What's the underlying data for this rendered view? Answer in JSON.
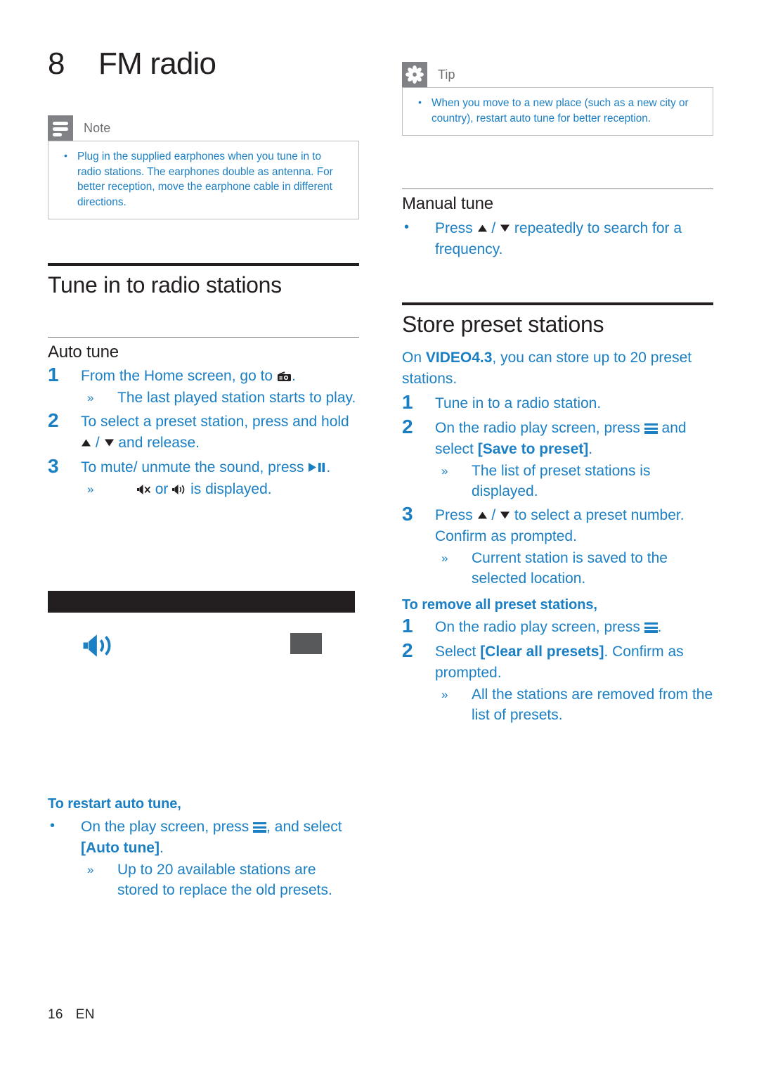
{
  "chapter": {
    "number": "8",
    "title": "FM radio"
  },
  "note_box": {
    "icon": "note-icon",
    "label": "Note",
    "items": [
      "Plug in the supplied earphones when you tune in to radio stations. The earphones double as antenna. For better reception, move the earphone cable in different directions."
    ]
  },
  "tip_box": {
    "icon": "tip-icon",
    "label": "Tip",
    "items": [
      "When you move to a new place (such as a new city or country), restart auto tune for better reception."
    ]
  },
  "section_tune": {
    "heading": "Tune in to radio stations",
    "auto_tune": {
      "heading": "Auto tune",
      "steps": [
        {
          "num": "1",
          "text_before": "From the Home screen, go to",
          "icon": "radio-icon",
          "text_after": ".",
          "results": [
            "The last played station starts to play."
          ]
        },
        {
          "num": "2",
          "text_before": "To select a preset station, press and hold",
          "icon": "arrow-up-icon",
          "text_mid": "/",
          "icon2": "arrow-down-icon",
          "text_after": "and release.",
          "results": []
        },
        {
          "num": "3",
          "text_before": "To mute/ unmute the sound, press",
          "icon": "play-pause-icon",
          "text_after": ".",
          "results": [
            "or is displayed."
          ]
        }
      ],
      "mute_result_part1": "",
      "mute_result_or": "or",
      "mute_result_part2": "is displayed."
    },
    "restart": {
      "heading": "To restart auto tune,",
      "bullet_before": "On the play screen, press",
      "bullet_icon": "hamburger-menu-icon",
      "bullet_after": ", and select",
      "bullet_keyword": "[Auto tune]",
      "bullet_end": ".",
      "results": [
        "Up to 20 available stations are stored to replace the old presets."
      ]
    }
  },
  "section_manual": {
    "heading": "Manual tune",
    "bullet_before": "Press",
    "icon_up": "arrow-up-icon",
    "bullet_mid": "/",
    "icon_down": "arrow-down-icon",
    "bullet_after": "repeatedly to search for a frequency."
  },
  "section_store": {
    "heading": "Store preset stations",
    "intro_before": "On",
    "intro_model": "VIDEO4.3",
    "intro_after": ", you can store up to 20 preset stations.",
    "steps": [
      {
        "num": "1",
        "text": "Tune in to a radio station.",
        "results": []
      },
      {
        "num": "2",
        "text_before": "On the radio play screen, press",
        "icon": "hamburger-menu-icon",
        "text_mid": "and select",
        "keyword": "[Save to preset]",
        "text_after": ".",
        "results": [
          "The list of preset stations is displayed."
        ]
      },
      {
        "num": "3",
        "text_before": "Press",
        "icon_up": "arrow-up-icon",
        "text_sep": "/",
        "icon_down": "arrow-down-icon",
        "text_after": "to select a preset number. Confirm as prompted.",
        "results": [
          "Current station is saved to the selected location."
        ]
      }
    ],
    "remove": {
      "heading": "To remove all preset stations,",
      "steps": [
        {
          "num": "1",
          "text_before": "On the radio play screen, press",
          "icon": "hamburger-menu-icon",
          "text_after": ".",
          "results": []
        },
        {
          "num": "2",
          "text_before": "Select",
          "keyword": "[Clear all presets]",
          "text_after": ". Confirm as prompted.",
          "results": [
            "All the stations are removed from the list of presets."
          ]
        }
      ]
    }
  },
  "figure": {
    "name": "fm-radio-play-screen-illustration",
    "speaker_icon": "speaker-volume-icon",
    "chip": "preset-indicator-block"
  },
  "footer": {
    "page": "16",
    "language": "EN"
  },
  "colors": {
    "body_blue": "#1b7fc4",
    "heading_black": "#231f20",
    "badge_gray": "#808285",
    "callout_border": "#bcbec0",
    "figure_bar": "#231f20",
    "figure_chip": "#58595b"
  }
}
